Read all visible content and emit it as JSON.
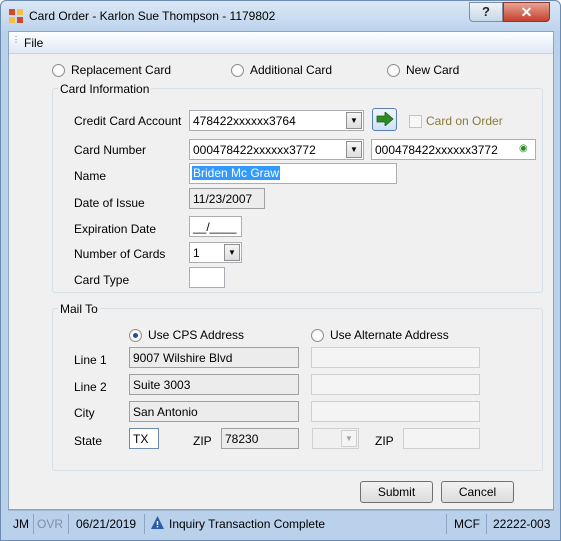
{
  "window": {
    "title": "Card Order - Karlon Sue Thompson - 1179802",
    "help_label": "?",
    "close_label": "✕"
  },
  "menu": {
    "file": "File"
  },
  "order_type": {
    "options": [
      "Replacement Card",
      "Additional Card",
      "New Card"
    ]
  },
  "card_info": {
    "legend": "Card Information",
    "credit_card_account_label": "Credit Card Account",
    "credit_card_account_value": "478422xxxxxx3764",
    "card_on_order_label": "Card on Order",
    "card_number_label": "Card Number",
    "card_number_value": "000478422xxxxxx3772",
    "card_number_display": "000478422xxxxxx3772",
    "name_label": "Name",
    "name_value": "Briden Mc Graw",
    "date_of_issue_label": "Date of Issue",
    "date_of_issue_value": "11/23/2007",
    "expiration_date_label": "Expiration Date",
    "expiration_date_value": "__/____",
    "number_of_cards_label": "Number of Cards",
    "number_of_cards_value": "1",
    "card_type_label": "Card Type",
    "card_type_value": ""
  },
  "mail_to": {
    "legend": "Mail To",
    "use_cps_label": "Use CPS Address",
    "use_alternate_label": "Use Alternate Address",
    "line1_label": "Line 1",
    "line1_value": "9007 Wilshire Blvd",
    "line2_label": "Line 2",
    "line2_value": "Suite 3003",
    "city_label": "City",
    "city_value": "San Antonio",
    "state_label": "State",
    "state_value": "TX",
    "zip_label": "ZIP",
    "zip_value": "78230",
    "alt_zip_label": "ZIP"
  },
  "buttons": {
    "submit": "Submit",
    "cancel": "Cancel"
  },
  "status": {
    "user": "JM",
    "mode": "OVR",
    "date": "06/21/2019",
    "message": "Inquiry Transaction Complete",
    "system": "MCF",
    "code": "22222-003"
  },
  "colors": {
    "titlebar": "#bcd3ec",
    "accent_green": "#2e8b24",
    "selection": "#3399ff",
    "status_bar": "#b9d1ea"
  }
}
